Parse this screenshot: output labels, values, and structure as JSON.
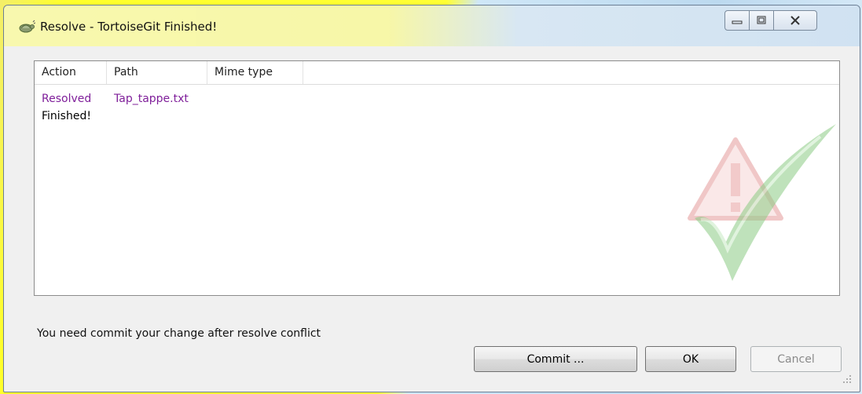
{
  "window": {
    "title": "Resolve - TortoiseGit Finished!",
    "controls": {
      "minimize": "minimize",
      "maximize": "maximize",
      "close": "close"
    }
  },
  "list": {
    "columns": [
      "Action",
      "Path",
      "Mime type"
    ],
    "rows": [
      {
        "action": "Resolved",
        "path": "Tap_tappe.txt",
        "mime": ""
      },
      {
        "action": "Finished!",
        "path": "",
        "mime": ""
      }
    ]
  },
  "status_message": "You need commit your change after resolve conflict",
  "buttons": {
    "commit": "Commit ...",
    "ok": "OK",
    "cancel": "Cancel"
  },
  "colors": {
    "resolved_text": "#7f1f9a",
    "warning_watermark": "#e8a0a0",
    "check_watermark": "#9fd39a"
  },
  "icons": {
    "app": "tortoise-icon",
    "watermark": "warning-check-watermark"
  }
}
